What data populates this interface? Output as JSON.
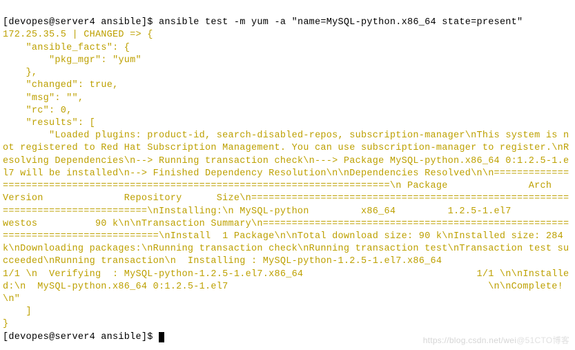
{
  "prompt1": {
    "host": "[devopes@server4 ansible]$ ",
    "command": "ansible test -m yum -a \"name=MySQL-python.x86_64 state=present\""
  },
  "output": {
    "line_host": "172.25.35.5 | CHANGED => {",
    "l2": "    \"ansible_facts\": {",
    "l3": "        \"pkg_mgr\": \"yum\"",
    "l4": "    },",
    "l5": "    \"changed\": true,",
    "l6": "    \"msg\": \"\",",
    "l7": "    \"rc\": 0,",
    "l8": "    \"results\": [",
    "l9": "        \"Loaded plugins: product-id, search-disabled-repos, subscription-manager\\nThis system is not registered to Red Hat Subscription Management. You can use subscription-manager to register.\\nResolving Dependencies\\n--> Running transaction check\\n---> Package MySQL-python.x86_64 0:1.2.5-1.el7 will be installed\\n--> Finished Dependency Resolution\\n\\nDependencies Resolved\\n\\n================================================================================\\n Package              Arch           Version              Repository      Size\\n================================================================================\\nInstalling:\\n MySQL-python         x86_64         1.2.5-1.el7          westos          90 k\\n\\nTransaction Summary\\n================================================================================\\nInstall  1 Package\\n\\nTotal download size: 90 k\\nInstalled size: 284 k\\nDownloading packages:\\nRunning transaction check\\nRunning transaction test\\nTransaction test succeeded\\nRunning transaction\\n  Installing : MySQL-python-1.2.5-1.el7.x86_64                              1/1 \\n  Verifying  : MySQL-python-1.2.5-1.el7.x86_64                              1/1 \\n\\nInstalled:\\n  MySQL-python.x86_64 0:1.2.5-1.el7                                             \\n\\nComplete!\\n\"",
    "l10": "    ]",
    "l11": "}"
  },
  "prompt2": {
    "host": "[devopes@server4 ansible]$ "
  },
  "watermark": {
    "left": "https://blog.csdn.net/wei",
    "right": "@51CTO博客"
  }
}
